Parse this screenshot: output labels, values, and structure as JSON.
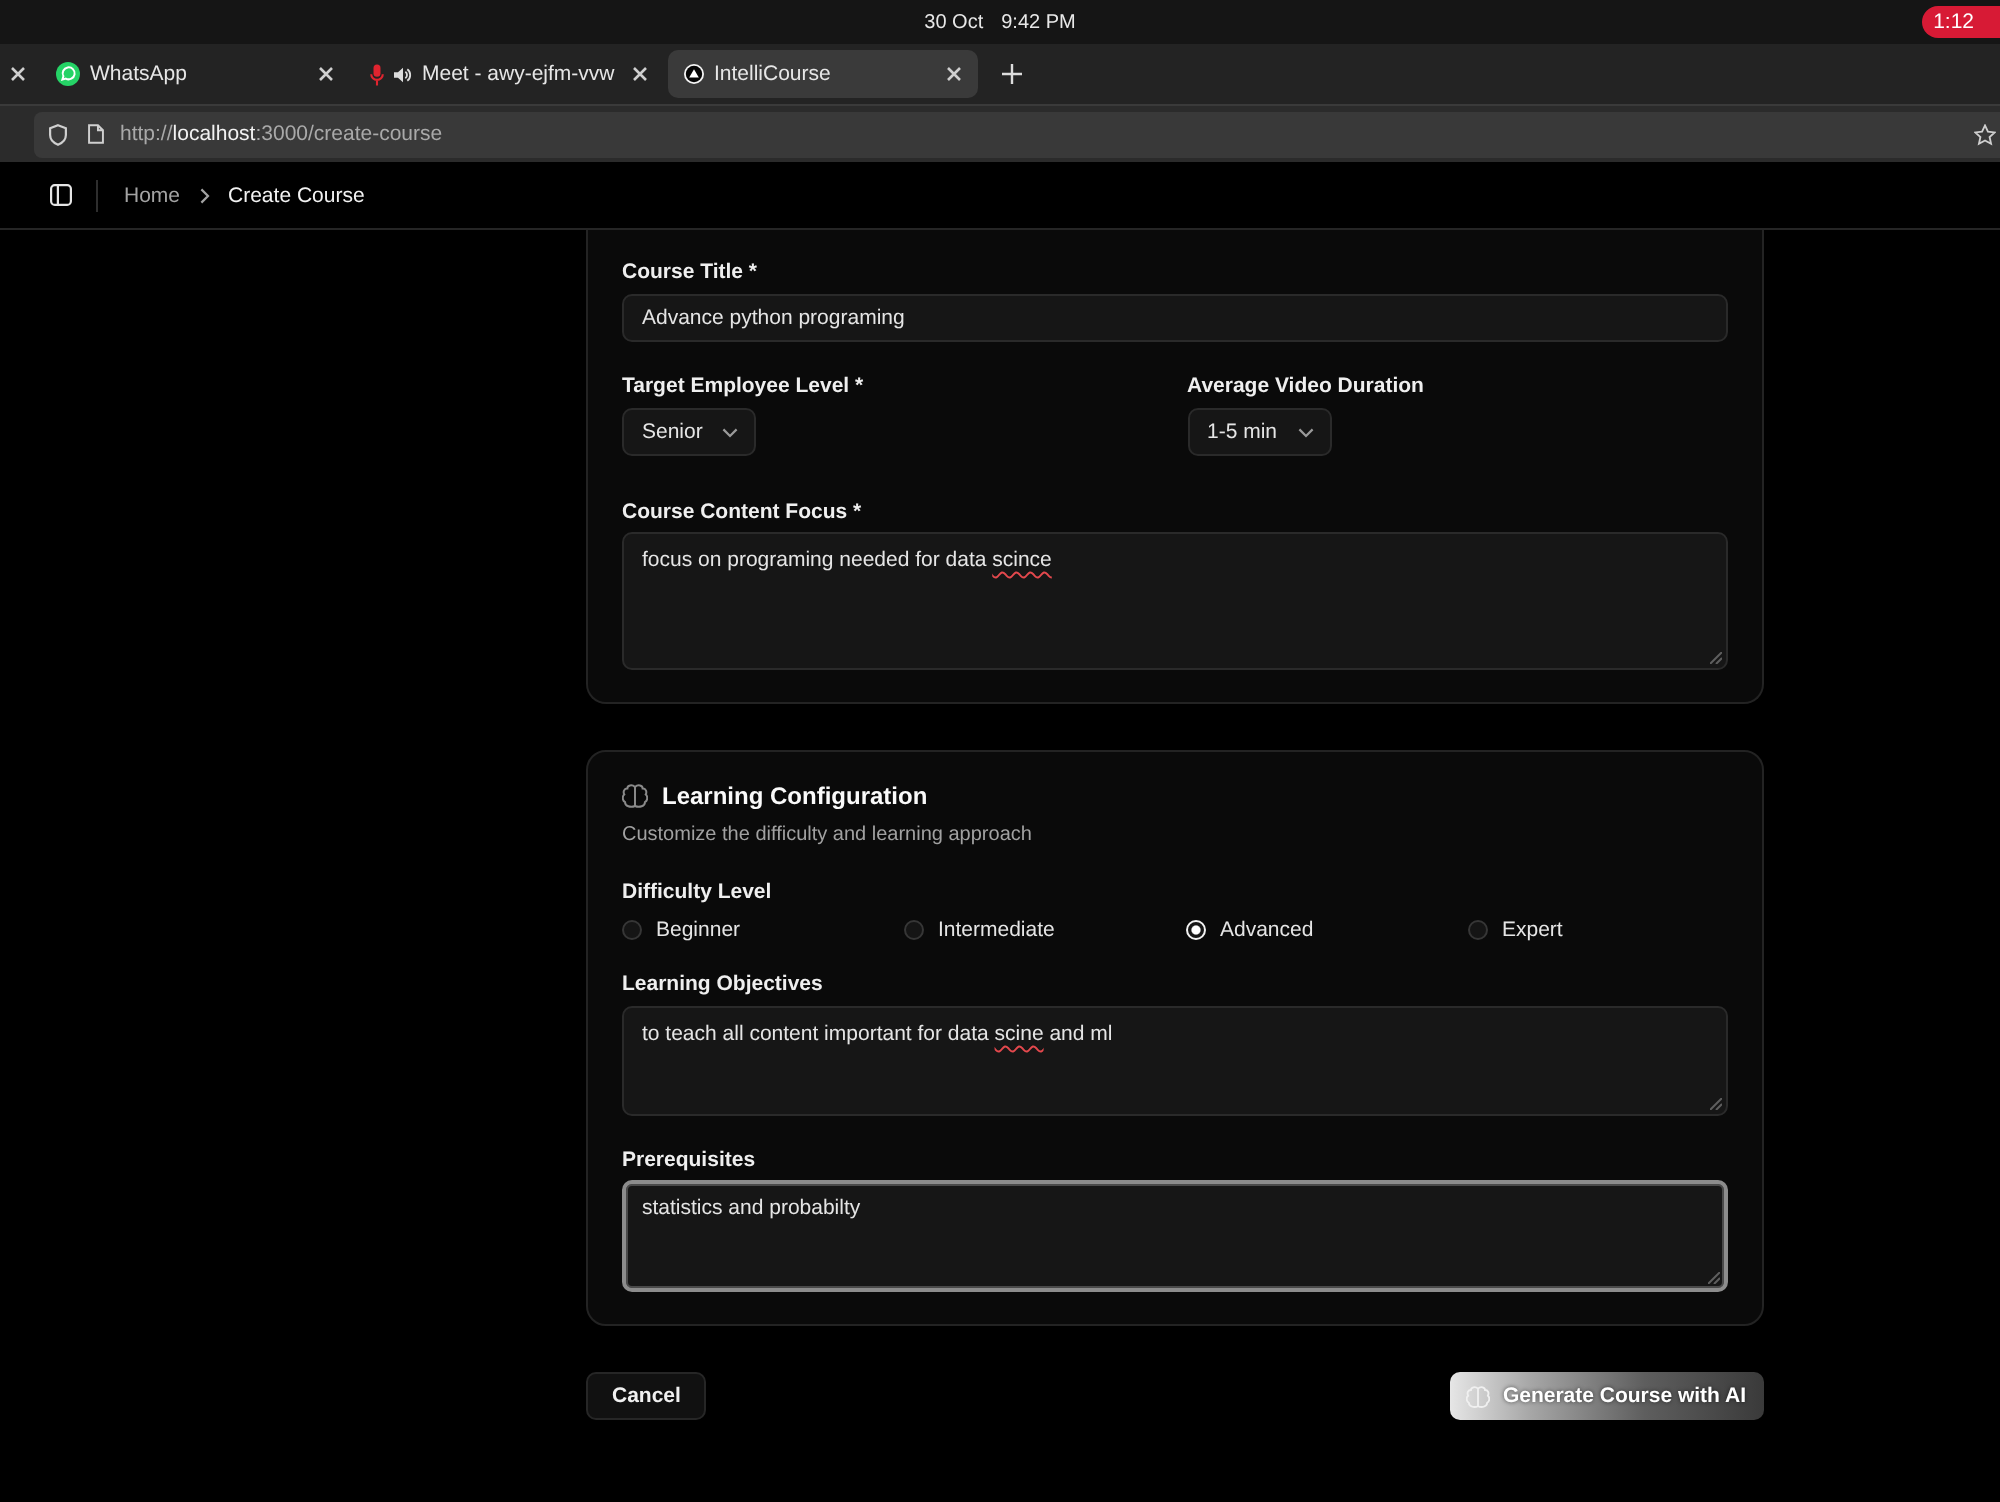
{
  "system_bar": {
    "date": "30 Oct",
    "time": "9:42 PM",
    "timer": "1:12"
  },
  "browser": {
    "tabs": [
      {
        "kind": "clipped",
        "selected": false,
        "mic_active": false,
        "audio_playing": false
      },
      {
        "kind": "chat",
        "title": "WhatsApp",
        "selected": false,
        "mic_active": false,
        "audio_playing": false
      },
      {
        "kind": "call",
        "title": "Meet - awy-ejfm-vvw",
        "selected": false,
        "mic_active": true,
        "audio_playing": true
      },
      {
        "kind": "app",
        "title": "IntelliCourse",
        "selected": true,
        "mic_active": false,
        "audio_playing": false
      }
    ],
    "url": "http://**localhost**:3000/create-course"
  },
  "app_header": {
    "breadcrumb": [
      {
        "label": "Home",
        "current": false
      },
      {
        "label": "Create Course",
        "current": true
      }
    ]
  },
  "course_details": {
    "course_title": {
      "label": "Course Title *",
      "value": "Advance python programing"
    },
    "employee_level": {
      "label": "Target Employee Level *",
      "value": "Senior"
    },
    "video_duration": {
      "label": "Average Video Duration",
      "value": "1-5 min"
    },
    "content_focus": {
      "label": "Course Content Focus *",
      "focused": false,
      "value": [
        {
          "text": "focus on programing needed for data ",
          "misspelled": false
        },
        {
          "text": "scince",
          "misspelled": true
        }
      ]
    }
  },
  "learning_configuration": {
    "title": "Learning Configuration",
    "subtitle": "Customize the difficulty and learning approach",
    "difficulty": {
      "label": "Difficulty Level",
      "options": [
        {
          "label": "Beginner",
          "selected": false
        },
        {
          "label": "Intermediate",
          "selected": false
        },
        {
          "label": "Advanced",
          "selected": true
        },
        {
          "label": "Expert",
          "selected": false
        }
      ]
    },
    "objectives": {
      "label": "Learning Objectives",
      "focused": false,
      "value": [
        {
          "text": "to teach all content important for data ",
          "misspelled": false
        },
        {
          "text": "scine",
          "misspelled": true
        },
        {
          "text": " and ml",
          "misspelled": false
        }
      ]
    },
    "prerequisites": {
      "label": "Prerequisites",
      "focused": true,
      "value": [
        {
          "text": "statistics and probabilty",
          "misspelled": false
        }
      ]
    }
  },
  "actions": {
    "cancel": "Cancel",
    "generate": "Generate Course with AI"
  }
}
